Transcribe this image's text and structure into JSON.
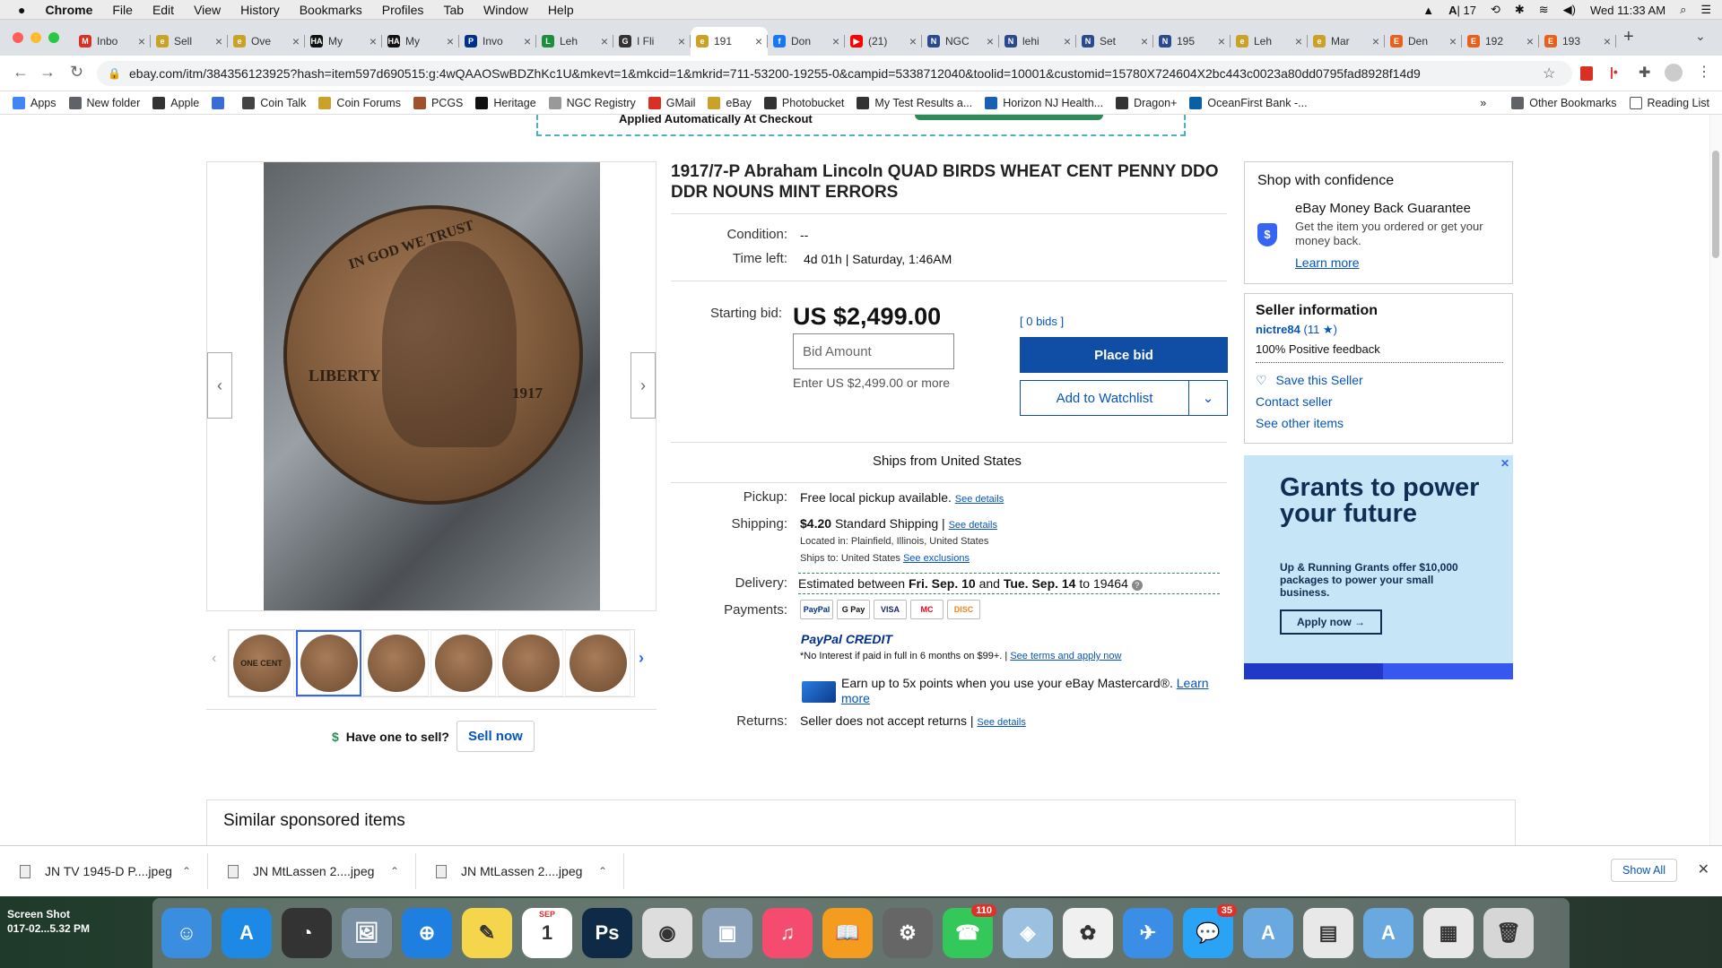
{
  "menubar": {
    "app": "Chrome",
    "items": [
      "File",
      "Edit",
      "View",
      "History",
      "Bookmarks",
      "Profiles",
      "Tab",
      "Window",
      "Help"
    ],
    "status_count": "17",
    "clock": "Wed 11:33 AM"
  },
  "tabs": [
    {
      "label": "Inbo",
      "color": "#d93025",
      "glyph": "M"
    },
    {
      "label": "Sell",
      "color": "#c9a227",
      "glyph": "e"
    },
    {
      "label": "Ove",
      "color": "#c9a227",
      "glyph": "e"
    },
    {
      "label": "My",
      "color": "#111111",
      "glyph": "HA"
    },
    {
      "label": "My",
      "color": "#111111",
      "glyph": "HA"
    },
    {
      "label": "Invo",
      "color": "#003087",
      "glyph": "P"
    },
    {
      "label": "Leh",
      "color": "#1e8e3e",
      "glyph": "L"
    },
    {
      "label": "I Fli",
      "color": "#333333",
      "glyph": "G"
    },
    {
      "label": "191",
      "color": "#c9a227",
      "glyph": "e",
      "active": true
    },
    {
      "label": "Don",
      "color": "#1877f2",
      "glyph": "f"
    },
    {
      "label": "(21)",
      "color": "#ff0000",
      "glyph": "▶"
    },
    {
      "label": "NGC",
      "color": "#2b4a8b",
      "glyph": "N"
    },
    {
      "label": "lehi",
      "color": "#2b4a8b",
      "glyph": "N"
    },
    {
      "label": "Set",
      "color": "#2b4a8b",
      "glyph": "N"
    },
    {
      "label": "195",
      "color": "#2b4a8b",
      "glyph": "N"
    },
    {
      "label": "Leh",
      "color": "#c9a227",
      "glyph": "e"
    },
    {
      "label": "Mar",
      "color": "#c9a227",
      "glyph": "e"
    },
    {
      "label": "Den",
      "color": "#e8601c",
      "glyph": "E"
    },
    {
      "label": "192",
      "color": "#e8601c",
      "glyph": "E"
    },
    {
      "label": "193",
      "color": "#e8601c",
      "glyph": "E"
    }
  ],
  "url": "ebay.com/itm/384356123925?hash=item597d690515:g:4wQAAOSwBDZhKc1U&mkevt=1&mkcid=1&mkrid=711-53200-19255-0&campid=5338712040&toolid=10001&customid=15780X724604X2bc443c0023a80dd0795fad8928f14d9",
  "bookmarks": [
    {
      "label": "Apps",
      "color": "#4285f4"
    },
    {
      "label": "New folder",
      "color": "#5f6368"
    },
    {
      "label": "Apple",
      "color": "#333333"
    },
    {
      "label": "",
      "color": "#3a6bd6"
    },
    {
      "label": "Coin Talk",
      "color": "#444444"
    },
    {
      "label": "Coin Forums",
      "color": "#c9a227"
    },
    {
      "label": "PCGS",
      "color": "#a0522d"
    },
    {
      "label": "Heritage",
      "color": "#111111"
    },
    {
      "label": "NGC Registry",
      "color": "#999999"
    },
    {
      "label": "GMail",
      "color": "#d93025"
    },
    {
      "label": "eBay",
      "color": "#c9a227"
    },
    {
      "label": "Photobucket",
      "color": "#333333"
    },
    {
      "label": "My Test Results a...",
      "color": "#333333"
    },
    {
      "label": "Horizon NJ Health...",
      "color": "#1a5fb4"
    },
    {
      "label": "Dragon+",
      "color": "#333333"
    },
    {
      "label": "OceanFirst Bank -...",
      "color": "#0b5fa5"
    }
  ],
  "bookmarks_right": [
    "Other Bookmarks",
    "Reading List"
  ],
  "coupon_text": "Applied Automatically At Checkout",
  "listing": {
    "title": "1917/7-P Abraham Lincoln QUAD BIRDS WHEAT CENT PENNY DDO DDR NOUNS MINT ERRORS",
    "condition_label": "Condition:",
    "condition_value": "--",
    "timeleft_label": "Time left:",
    "timeleft_value": "4d 01h",
    "timeleft_end": "Saturday, 1:46AM",
    "startbid_label": "Starting bid:",
    "price": "US $2,499.00",
    "bid_placeholder": "Bid Amount",
    "bid_hint": "Enter US $2,499.00 or more",
    "bids": "[ 0 bids ]",
    "place_bid": "Place bid",
    "watchlist": "Add to Watchlist",
    "ships_from": "Ships from United States",
    "pickup_label": "Pickup:",
    "pickup_value": "Free local pickup available.",
    "see_details": "See details",
    "shipping_label": "Shipping:",
    "shipping_price": "$4.20",
    "shipping_method": "Standard Shipping |",
    "located": "Located in:  Plainfield, Illinois, United States",
    "ships_to_label": "Ships to:  United States",
    "see_exclusions": "See exclusions",
    "delivery_label": "Delivery:",
    "delivery_pre": "Estimated between",
    "delivery_from": "Fri. Sep. 10",
    "delivery_and": "and",
    "delivery_to": "Tue. Sep. 14",
    "delivery_zip": "to 19464",
    "payments_label": "Payments:",
    "pay_logos": [
      "PayPal",
      "G Pay",
      "VISA",
      "MC",
      "DISC"
    ],
    "paypal_credit": "PayPal CREDIT",
    "credit_note": "*No Interest if paid in full in 6 months on $99+.  |",
    "credit_link": "See terms and apply now",
    "mastercard_text": "Earn up to 5x points when you use your eBay Mastercard®.",
    "learn_more": "Learn more",
    "returns_label": "Returns:",
    "returns_value": "Seller does not accept returns |",
    "coin_text_top": "IN GOD WE TRUST",
    "coin_text_liberty": "LIBERTY",
    "coin_text_year": "1917",
    "thumb_first_text": "ONE CENT"
  },
  "gallery": {
    "prev": "‹",
    "next": "›",
    "have_one": "Have one to sell?",
    "sell_now": "Sell now"
  },
  "confidence": {
    "title": "Shop with confidence",
    "guarantee_title": "eBay Money Back Guarantee",
    "guarantee_text": "Get the item you ordered or get your money back.",
    "learn_more": "Learn more"
  },
  "seller": {
    "title": "Seller information",
    "name": "nictre84",
    "score": "(11 ★)",
    "feedback": "100% Positive feedback",
    "save": "Save this Seller",
    "contact": "Contact seller",
    "other": "See other items"
  },
  "ad": {
    "headline": "Grants to power your future",
    "sub": "Up & Running Grants offer $10,000 packages to power your small business.",
    "cta": "Apply now  →"
  },
  "similar_title": "Similar sponsored items",
  "downloads": [
    "JN TV 1945-D P....jpeg",
    "JN MtLassen 2....jpeg",
    "JN MtLassen 2....jpeg"
  ],
  "show_all": "Show All",
  "desktop_label": "Screen Shot\n017-02...5.32 PM",
  "dock": [
    {
      "name": "finder",
      "color": "#3b8de0",
      "glyph": "☺"
    },
    {
      "name": "app-store",
      "color": "#1e88e5",
      "glyph": "A"
    },
    {
      "name": "dashboard",
      "color": "#333333",
      "glyph": "◔"
    },
    {
      "name": "preview",
      "color": "#7b8fa3",
      "glyph": "🖼"
    },
    {
      "name": "safari",
      "color": "#1e7fe0",
      "glyph": "⊕"
    },
    {
      "name": "stickies",
      "color": "#f5d54b",
      "glyph": "✎"
    },
    {
      "name": "calendar",
      "color": "#ffffff",
      "glyph": "1",
      "text": "SEP"
    },
    {
      "name": "photoshop",
      "color": "#0e2a47",
      "glyph": "Ps"
    },
    {
      "name": "chrome",
      "color": "#dddddd",
      "glyph": "◉"
    },
    {
      "name": "image-capture",
      "color": "#8aa0b8",
      "glyph": "▣"
    },
    {
      "name": "itunes",
      "color": "#f54b6e",
      "glyph": "♫"
    },
    {
      "name": "ibooks",
      "color": "#f39c1f",
      "glyph": "📖"
    },
    {
      "name": "system-prefs",
      "color": "#666666",
      "glyph": "⚙"
    },
    {
      "name": "facetime",
      "color": "#34c759",
      "glyph": "☎",
      "badge": "110"
    },
    {
      "name": "maps",
      "color": "#9bc0e0",
      "glyph": "◈"
    },
    {
      "name": "photos",
      "color": "#f0f0f0",
      "glyph": "✿"
    },
    {
      "name": "mail",
      "color": "#3a8ee6",
      "glyph": "✈"
    },
    {
      "name": "messages",
      "color": "#2aa3f5",
      "glyph": "💬",
      "badge": "35"
    },
    {
      "name": "applications-folder",
      "color": "#6aa8e0",
      "glyph": "A"
    },
    {
      "name": "documents",
      "color": "#e8e8e8",
      "glyph": "▤"
    },
    {
      "name": "downloads-folder",
      "color": "#6aa8e0",
      "glyph": "A"
    },
    {
      "name": "screenshots",
      "color": "#e8e8e8",
      "glyph": "▦"
    },
    {
      "name": "trash",
      "color": "#d6d6d6",
      "glyph": "🗑"
    }
  ]
}
